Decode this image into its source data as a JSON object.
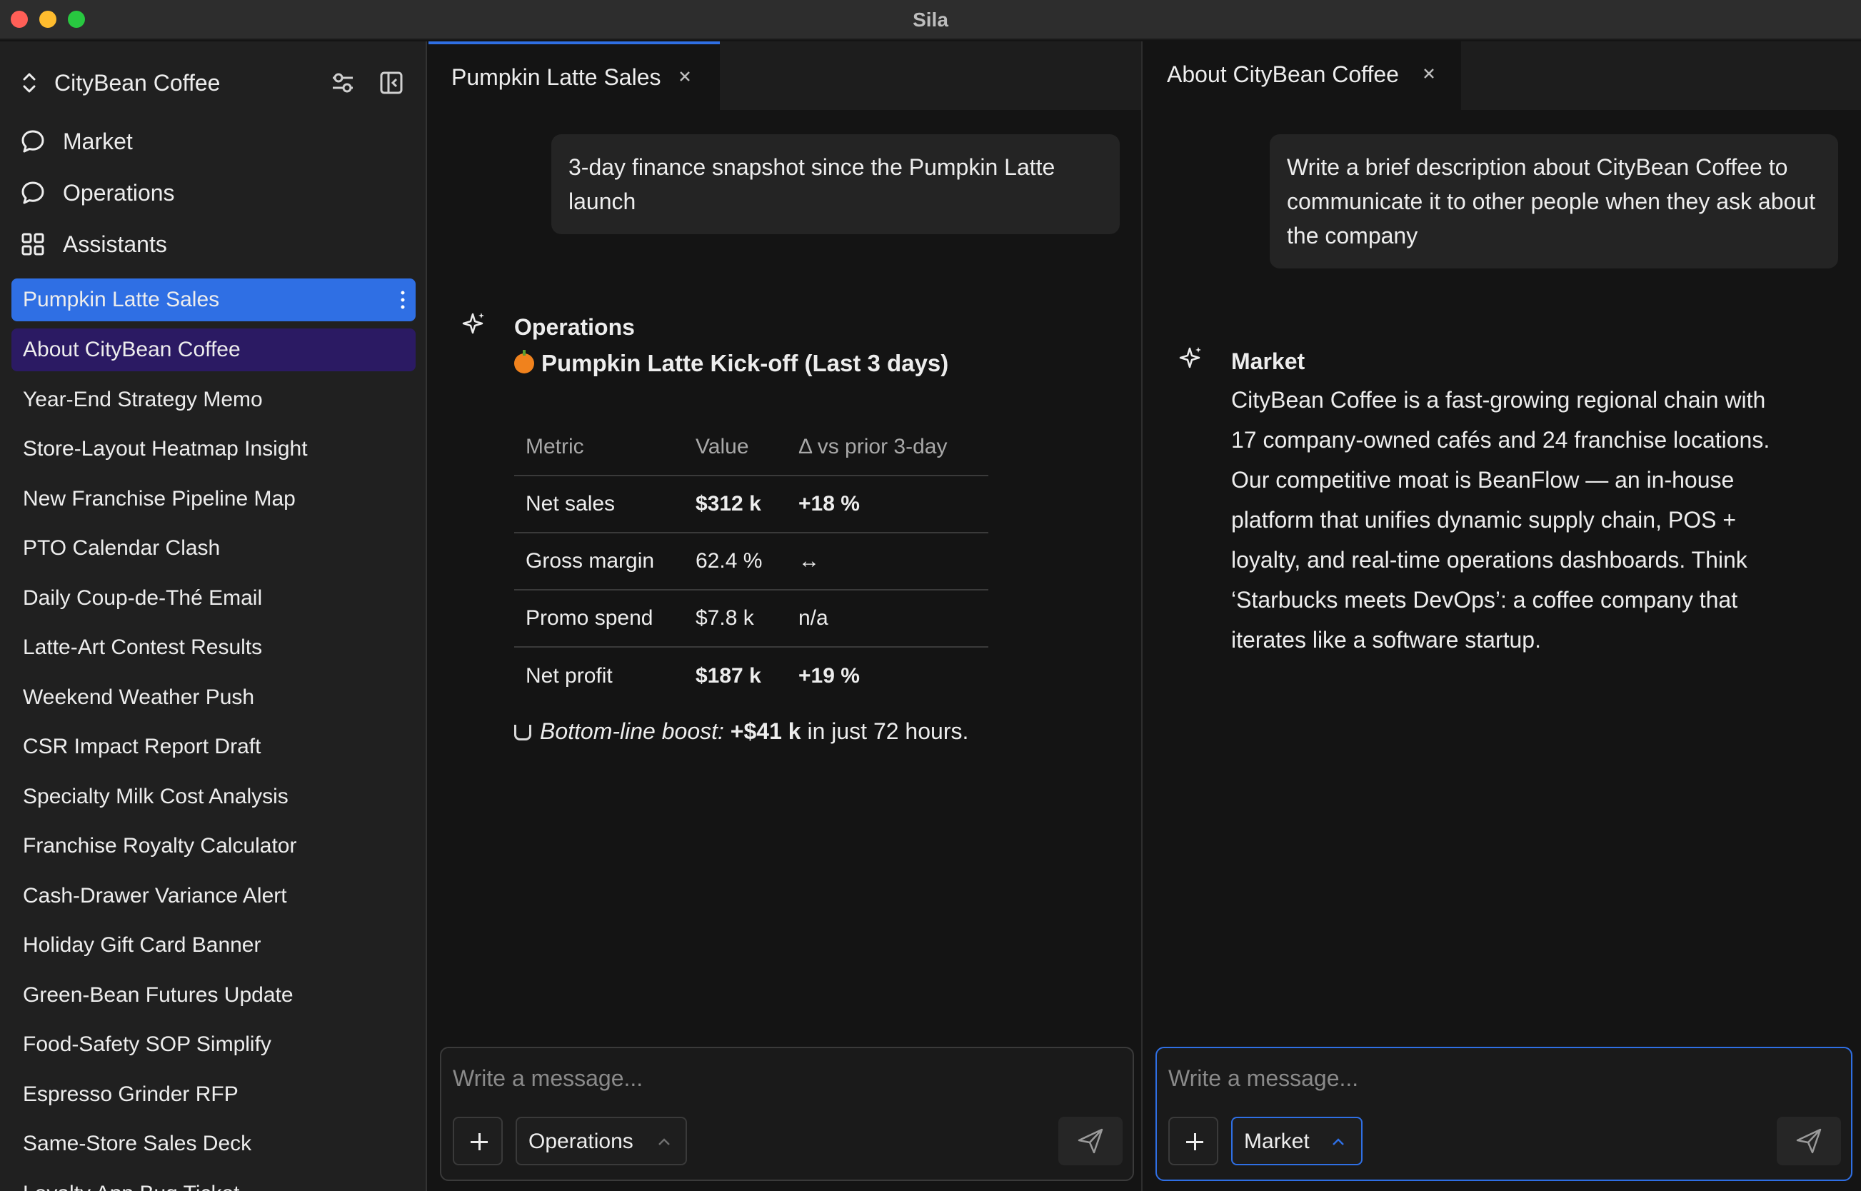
{
  "window": {
    "title": "Sila"
  },
  "sidebar": {
    "workspace_name": "CityBean Coffee",
    "nav": [
      {
        "label": "Market",
        "icon": "chat-bubble-icon"
      },
      {
        "label": "Operations",
        "icon": "chat-bubble-icon"
      },
      {
        "label": "Assistants",
        "icon": "grid-icon"
      }
    ],
    "conversations": [
      "Pumpkin Latte Sales",
      "About CityBean Coffee",
      "Year-End Strategy Memo",
      "Store-Layout Heatmap Insight",
      "New Franchise Pipeline Map",
      "PTO Calendar Clash",
      "Daily Coup-de-Thé Email",
      "Latte-Art Contest Results",
      "Weekend Weather Push",
      "CSR Impact Report Draft",
      "Specialty Milk Cost Analysis",
      "Franchise Royalty Calculator",
      "Cash-Drawer Variance Alert",
      "Holiday Gift Card Banner",
      "Green-Bean Futures Update",
      "Food-Safety SOP Simplify",
      "Espresso Grinder RFP",
      "Same-Store Sales Deck",
      "Loyalty App Bug Ticket"
    ],
    "active_conversation": "Pumpkin Latte Sales",
    "secondary_conversation": "About CityBean Coffee"
  },
  "left_pane": {
    "tab_label": "Pumpkin Latte Sales",
    "user_message": "3-day finance snapshot since the Pumpkin Latte launch",
    "assistant_name": "Operations",
    "heading": "Pumpkin Latte Kick-off (Last 3 days)",
    "table": {
      "headers": [
        "Metric",
        "Value",
        "Δ vs prior 3-day"
      ],
      "rows": [
        [
          "Net sales",
          "$312 k",
          "+18 %"
        ],
        [
          "Gross margin",
          "62.4 %",
          "↔"
        ],
        [
          "Promo spend",
          "$7.8 k",
          "n/a"
        ],
        [
          "Net profit",
          "$187 k",
          "+19 %"
        ]
      ]
    },
    "summary": {
      "italic": "Bottom-line boost:",
      "bold": "+$41 k",
      "rest": " in just 72 hours."
    },
    "composer": {
      "placeholder": "Write a message...",
      "assistant": "Operations"
    }
  },
  "right_pane": {
    "tab_label": "About CityBean Coffee",
    "user_message": "Write a brief description about CityBean Coffee to communicate it to other people when they ask about the company",
    "assistant_name": "Market",
    "answer": "CityBean Coffee is a fast-growing regional chain with 17 company-owned cafés and 24 franchise locations. Our competitive moat is BeanFlow — an in-house platform that unifies dynamic supply chain, POS + loyalty, and real-time operations dashboards. Think ‘Starbucks meets DevOps’: a coffee company that iterates like a software startup.",
    "composer": {
      "placeholder": "Write a message...",
      "assistant": "Market"
    }
  },
  "colors": {
    "accent": "#2f6fe4",
    "secondary_highlight": "#2b1a63",
    "background": "#141414",
    "sidebar": "#202020"
  }
}
